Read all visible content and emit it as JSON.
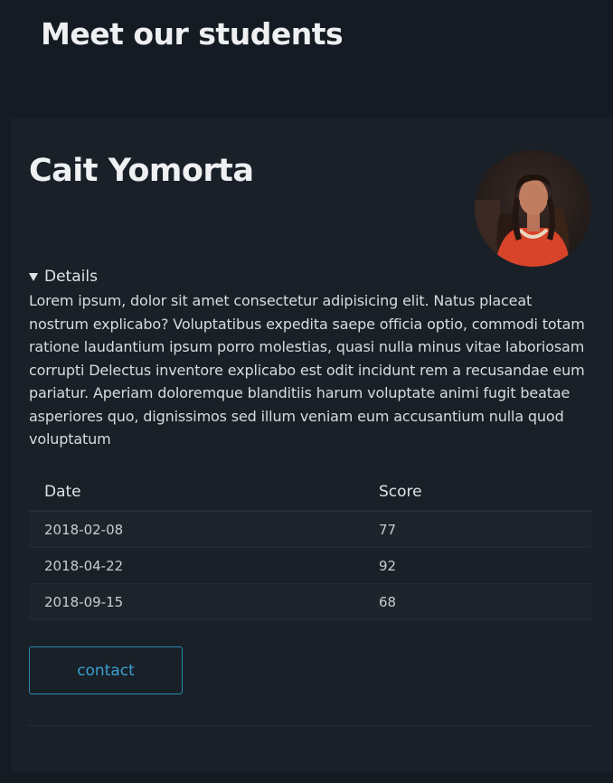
{
  "header": {
    "title": "Meet our students"
  },
  "student": {
    "name": "Cait Yomorta",
    "avatar_icon": "student-photo",
    "details_label": "Details",
    "details_text": "Lorem ipsum, dolor sit amet consectetur adipisicing elit. Natus placeat nostrum explicabo? Voluptatibus expedita saepe officia optio, commodi totam ratione laudantium ipsum porro molestias, quasi nulla minus vitae laboriosam corrupti Delectus inventore explicabo est odit incidunt rem a recusandae eum pariatur. Aperiam doloremque blanditiis harum voluptate animi fugit beatae asperiores quo, dignissimos sed illum veniam eum accusantium nulla quod voluptatum",
    "table": {
      "columns": [
        "Date",
        "Score"
      ],
      "rows": [
        {
          "date": "2018-02-08",
          "score": "77"
        },
        {
          "date": "2018-04-22",
          "score": "92"
        },
        {
          "date": "2018-09-15",
          "score": "68"
        }
      ]
    },
    "contact_label": "contact"
  },
  "colors": {
    "background": "#151b22",
    "card": "#192028",
    "accent": "#3aa0d0"
  }
}
